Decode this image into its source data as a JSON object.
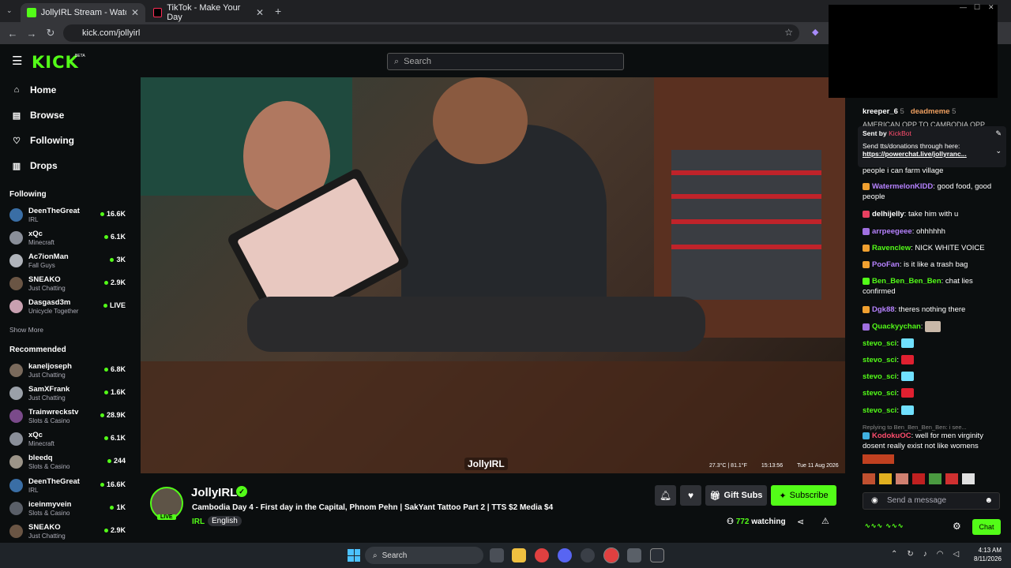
{
  "browser": {
    "tabs": [
      {
        "title": "JollyIRL Stream - Watch Live",
        "active": true
      },
      {
        "title": "TikTok - Make Your Day",
        "active": false
      }
    ],
    "url": "kick.com/jollyirl"
  },
  "header": {
    "logo": "KICK",
    "logo_badge": "BETA",
    "search_placeholder": "Search"
  },
  "sidebar": {
    "nav": [
      {
        "label": "Home",
        "icon": "home-icon"
      },
      {
        "label": "Browse",
        "icon": "browse-icon"
      },
      {
        "label": "Following",
        "icon": "heart-icon"
      },
      {
        "label": "Drops",
        "icon": "drops-icon"
      }
    ],
    "following_title": "Following",
    "following": [
      {
        "name": "DeenTheGreat",
        "category": "IRL",
        "viewers": "16.6K"
      },
      {
        "name": "xQc",
        "category": "Minecraft",
        "viewers": "6.1K"
      },
      {
        "name": "Ac7ionMan",
        "category": "Fall Guys",
        "viewers": "3K"
      },
      {
        "name": "SNEAKO",
        "category": "Just Chatting",
        "viewers": "2.9K"
      },
      {
        "name": "Dasgasd3m",
        "category": "Unicycle Together",
        "viewers": "LIVE"
      }
    ],
    "show_more": "Show More",
    "recommended_title": "Recommended",
    "recommended": [
      {
        "name": "kaneljoseph",
        "category": "Just Chatting",
        "viewers": "6.8K"
      },
      {
        "name": "SamXFrank",
        "category": "Just Chatting",
        "viewers": "1.6K"
      },
      {
        "name": "Trainwreckstv",
        "category": "Slots & Casino",
        "viewers": "28.9K"
      },
      {
        "name": "xQc",
        "category": "Minecraft",
        "viewers": "6.1K"
      },
      {
        "name": "bleedq",
        "category": "Slots & Casino",
        "viewers": "244"
      },
      {
        "name": "DeenTheGreat",
        "category": "IRL",
        "viewers": "16.6K"
      },
      {
        "name": "iceinmyvein",
        "category": "Slots & Casino",
        "viewers": "1K"
      },
      {
        "name": "SNEAKO",
        "category": "Just Chatting",
        "viewers": "2.9K"
      }
    ]
  },
  "video": {
    "watermark": "JollyIRL",
    "overlay": {
      "temp": "27.3°C | 81.1°F",
      "time": "15:13:56",
      "date": "Tue 11 Aug 2026"
    }
  },
  "stream": {
    "live_badge": "LIVE",
    "name": "JollyIRL",
    "title": "Cambodia Day 4 - First day in the Capital, Phnom Pehn | SakYant Tattoo Part 2 | TTS $2 Media $4",
    "category": "IRL",
    "language": "English",
    "viewers": "772",
    "watching_label": "watching",
    "gift_label": "Gift Subs",
    "subscribe_label": "Subscribe"
  },
  "chat": {
    "top_users": [
      {
        "name": "kreeper_6",
        "count": "5"
      },
      {
        "name": "deadmeme",
        "count": "5"
      }
    ],
    "top_partial": "AMERICAN OPP TO CAMBODIA OPP",
    "pinned": {
      "sent_by_label": "Sent by",
      "sender": "KickBot",
      "text": "Send tts/donations through here:",
      "link": "https://powerchat.live/jollyranc..."
    },
    "partial_line": "people i can farm village",
    "messages": [
      {
        "user": "WatermelonKIDD",
        "color": "#b682ff",
        "text": "good food, good people"
      },
      {
        "user": "delhijelly",
        "color": "#ffffff",
        "text": "take him with u"
      },
      {
        "user": "arrpeegeee",
        "color": "#b682ff",
        "text": "ohhhhhh"
      },
      {
        "user": "Ravenclew",
        "color": "#53fc18",
        "text": "NICK WHITE VOICE"
      },
      {
        "user": "PooFan",
        "color": "#b682ff",
        "text": "is it like a trash bag"
      },
      {
        "user": "Ben_Ben_Ben_Ben",
        "color": "#53fc18",
        "text": "chat lies confirmed"
      },
      {
        "user": "Dgk88",
        "color": "#b682ff",
        "text": "theres nothing there"
      },
      {
        "user": "Quackyychan",
        "color": "#53fc18",
        "text": ""
      },
      {
        "user": "stevo_sci",
        "color": "#53fc18",
        "text": ""
      },
      {
        "user": "stevo_sci",
        "color": "#53fc18",
        "text": ""
      },
      {
        "user": "stevo_sci",
        "color": "#53fc18",
        "text": ""
      },
      {
        "user": "stevo_sci",
        "color": "#53fc18",
        "text": ""
      },
      {
        "user": "stevo_sci",
        "color": "#53fc18",
        "text": ""
      }
    ],
    "reply_to": "Replying to Ben_Ben_Ben_Ben: i see...",
    "reply_user": "KodokuOC",
    "reply_text": "well for men virginity dosent really exist not like womens",
    "input_placeholder": "Send a message",
    "chat_button": "Chat"
  },
  "taskbar": {
    "search": "Search",
    "time": "4:13 AM",
    "date": "8/11/2026"
  },
  "colors": {
    "accent": "#53fc18",
    "bg": "#0b0e0f"
  }
}
